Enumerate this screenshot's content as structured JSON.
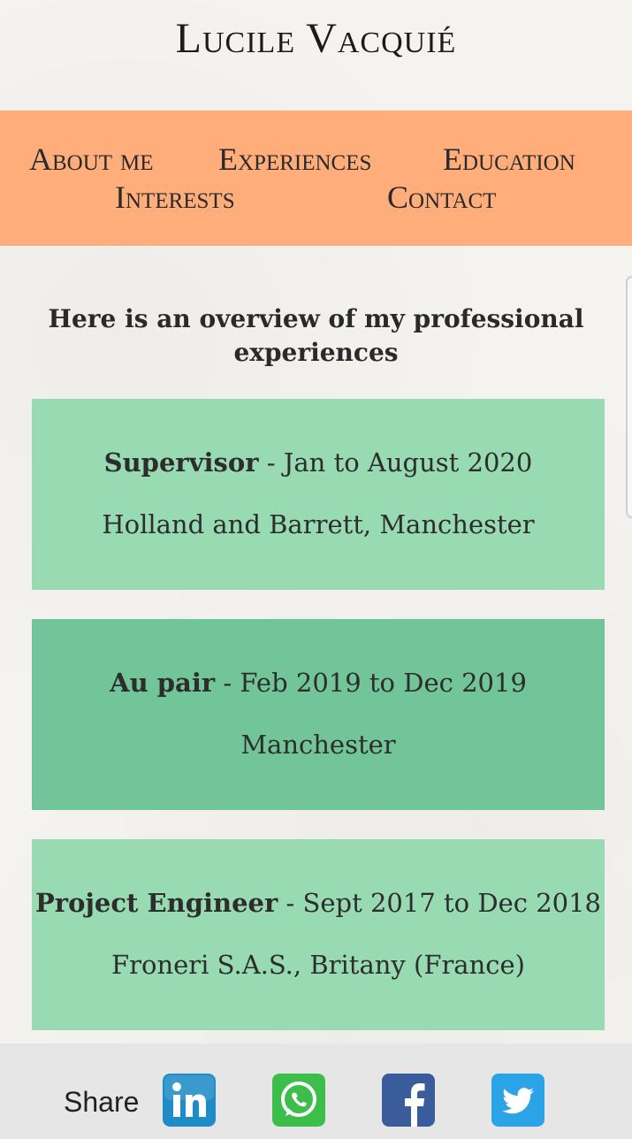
{
  "site": {
    "title": "Lucile Vacquié"
  },
  "nav": {
    "about": "About me",
    "experiences": "Experiences",
    "education": "Education",
    "interests": "Interests",
    "contact": "Contact"
  },
  "main": {
    "intro_line1": "Here is an overview of my professional",
    "intro_line2": "experiences",
    "experiences": [
      {
        "role": "Supervisor",
        "separator": " - ",
        "dates": "Jan to August 2020",
        "place": "Holland and Barrett, Manchester"
      },
      {
        "role": "Au pair",
        "separator": " - ",
        "dates": "Feb 2019 to Dec 2019",
        "place": "Manchester"
      },
      {
        "role": "Project Engineer",
        "separator": " - ",
        "dates": "Sept 2017 to Dec 2018",
        "place": "Froneri S.A.S., Britany (France)"
      }
    ]
  },
  "share": {
    "label": "Share",
    "buttons": [
      {
        "icon": "linkedin-icon",
        "color": "#1f8cc7"
      },
      {
        "icon": "whatsapp-icon",
        "color": "#3cbf4a"
      },
      {
        "icon": "facebook-icon",
        "color": "#3a5b9c"
      },
      {
        "icon": "twitter-icon",
        "color": "#2aa4e6"
      }
    ]
  },
  "colors": {
    "nav_background": "#ffad7b",
    "card_light": "#98dab2",
    "card_dark": "#72c598",
    "share_bar": "#e6e6e6"
  }
}
